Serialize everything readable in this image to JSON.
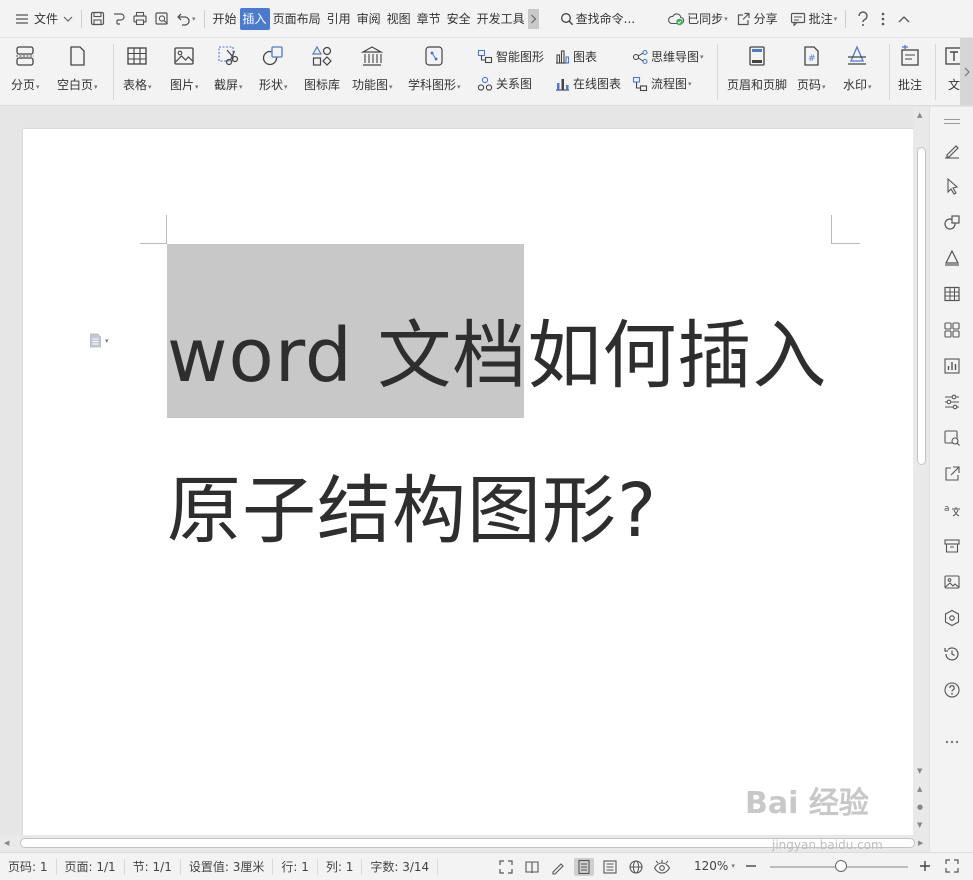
{
  "menubar": {
    "file": "文件",
    "tabs": [
      "开始",
      "插入",
      "页面布局",
      "引用",
      "审阅",
      "视图",
      "章节",
      "安全",
      "开发工具"
    ],
    "active_tab": "插入",
    "search": "查找命令...",
    "sync": "已同步",
    "share": "分享",
    "comment": "批注"
  },
  "ribbon": {
    "page_break": "分页",
    "blank_page": "空白页",
    "table": "表格",
    "picture": "图片",
    "screenshot": "截屏",
    "shape": "形状",
    "icon_lib": "图标库",
    "function_chart": "功能图",
    "science_chart": "学科图形",
    "smart_art": "智能图形",
    "relation": "关系图",
    "chart": "图表",
    "online_chart": "在线图表",
    "mind_map": "思维导图",
    "flowchart": "流程图",
    "header_footer": "页眉和页脚",
    "page_number": "页码",
    "watermark": "水印",
    "comment": "批注",
    "text_cut": "文"
  },
  "document": {
    "line1": "word 文档如何插入",
    "line2": "原子结构图形?"
  },
  "statusbar": {
    "page_code": "页码: 1",
    "pages": "页面: 1/1",
    "section": "节: 1/1",
    "setting": "设置值: 3厘米",
    "row": "行: 1",
    "col": "列: 1",
    "words": "字数: 3/14",
    "zoom": "120%"
  },
  "watermark": {
    "brand": "Bai 经验",
    "url": "jingyan.baidu.com"
  },
  "colors": {
    "accent": "#4a7bd0",
    "selection": "#c8c8c8"
  }
}
